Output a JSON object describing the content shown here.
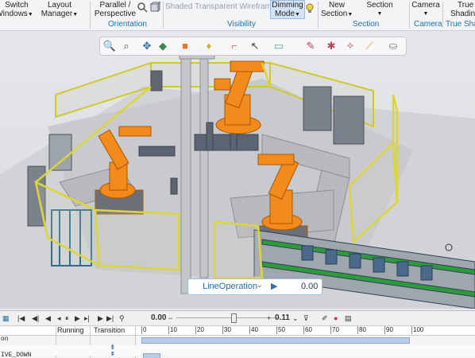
{
  "ribbon": {
    "switch_windows": [
      "Switch",
      "Windows"
    ],
    "layout_manager": [
      "Layout",
      "Manager"
    ],
    "parallel_perspective": [
      "Parallel /",
      "Perspective"
    ],
    "orientation_label": "Orientation",
    "shaded_transparent_wireframe": "Shaded Transparent Wireframe",
    "dimming_mode": [
      "Dimming",
      "Mode"
    ],
    "visibility_label": "Visibility",
    "new_section": [
      "New",
      "Section"
    ],
    "section": "Section",
    "section_label": "Section",
    "camera": "Camera",
    "camera_label": "Camera",
    "true_shading": [
      "True",
      "Shading"
    ],
    "true_shading_label": "True Shad"
  },
  "viewport": {
    "line_operation": {
      "name": "LineOperation",
      "value": "0.00"
    }
  },
  "sequence_editor": {
    "time_value": "0.00",
    "step_value": "0.11",
    "columns": {
      "running": "Running",
      "transition": "Transition"
    },
    "ruler_ticks": [
      "0",
      "10",
      "20",
      "30",
      "40",
      "50",
      "60",
      "70",
      "80",
      "90",
      "100"
    ],
    "rows": [
      {
        "label": "on"
      },
      {
        "label": "IVE_DOWN"
      }
    ]
  },
  "colors": {
    "robot": "#f28a1c",
    "fence": "#e6e04a",
    "accent": "#1f6fb2",
    "conveyor_green": "#2e9a3c"
  }
}
